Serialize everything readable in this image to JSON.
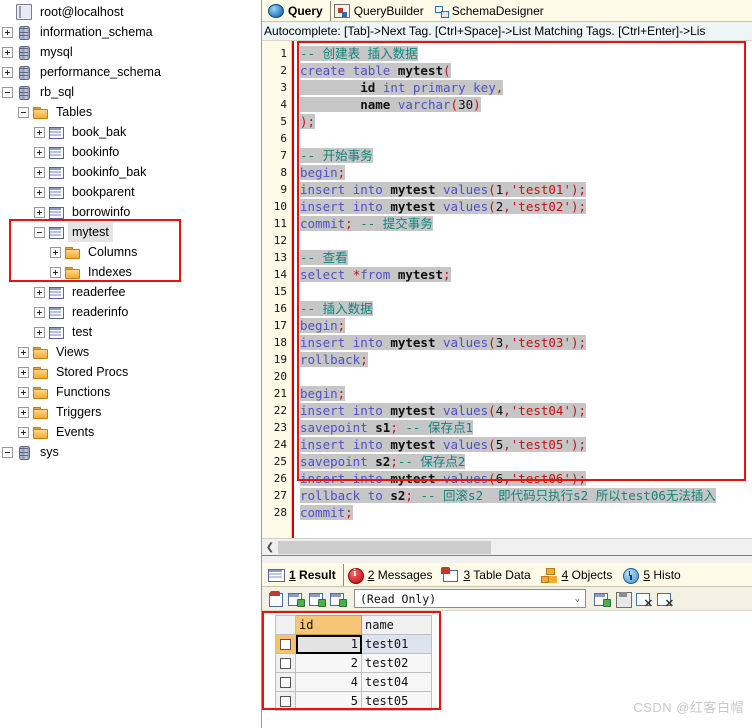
{
  "sidebar": {
    "items": [
      {
        "label": "root@localhost",
        "icon": "host-icon",
        "indent": 0,
        "expander": "none",
        "selected": false
      },
      {
        "label": "information_schema",
        "icon": "database-icon",
        "indent": 0,
        "expander": "plus",
        "selected": false
      },
      {
        "label": "mysql",
        "icon": "database-icon",
        "indent": 0,
        "expander": "plus",
        "selected": false
      },
      {
        "label": "performance_schema",
        "icon": "database-icon",
        "indent": 0,
        "expander": "plus",
        "selected": false
      },
      {
        "label": "rb_sql",
        "icon": "database-icon",
        "indent": 0,
        "expander": "minus",
        "selected": false
      },
      {
        "label": "Tables",
        "icon": "folder-icon",
        "indent": 1,
        "expander": "minus",
        "selected": false
      },
      {
        "label": "book_bak",
        "icon": "table-icon",
        "indent": 2,
        "expander": "plus",
        "selected": false
      },
      {
        "label": "bookinfo",
        "icon": "table-icon",
        "indent": 2,
        "expander": "plus",
        "selected": false
      },
      {
        "label": "bookinfo_bak",
        "icon": "table-icon",
        "indent": 2,
        "expander": "plus",
        "selected": false
      },
      {
        "label": "bookparent",
        "icon": "table-icon",
        "indent": 2,
        "expander": "plus",
        "selected": false
      },
      {
        "label": "borrowinfo",
        "icon": "table-icon",
        "indent": 2,
        "expander": "plus",
        "selected": false
      },
      {
        "label": "mytest",
        "icon": "table-icon",
        "indent": 2,
        "expander": "minus",
        "selected": true
      },
      {
        "label": "Columns",
        "icon": "folder-icon",
        "indent": 3,
        "expander": "plus",
        "selected": false
      },
      {
        "label": "Indexes",
        "icon": "folder-icon",
        "indent": 3,
        "expander": "plus",
        "selected": false
      },
      {
        "label": "readerfee",
        "icon": "table-icon",
        "indent": 2,
        "expander": "plus",
        "selected": false
      },
      {
        "label": "readerinfo",
        "icon": "table-icon",
        "indent": 2,
        "expander": "plus",
        "selected": false
      },
      {
        "label": "test",
        "icon": "table-icon",
        "indent": 2,
        "expander": "plus",
        "selected": false
      },
      {
        "label": "Views",
        "icon": "folder-icon",
        "indent": 1,
        "expander": "plus",
        "selected": false
      },
      {
        "label": "Stored Procs",
        "icon": "folder-icon",
        "indent": 1,
        "expander": "plus",
        "selected": false
      },
      {
        "label": "Functions",
        "icon": "folder-icon",
        "indent": 1,
        "expander": "plus",
        "selected": false
      },
      {
        "label": "Triggers",
        "icon": "folder-icon",
        "indent": 1,
        "expander": "plus",
        "selected": false
      },
      {
        "label": "Events",
        "icon": "folder-icon",
        "indent": 1,
        "expander": "plus",
        "selected": false
      },
      {
        "label": "sys",
        "icon": "database-icon",
        "indent": 0,
        "expander": "minus",
        "selected": false
      }
    ]
  },
  "editor_tabs": [
    {
      "label": "Query",
      "icon": "globe-icon",
      "active": true
    },
    {
      "label": "QueryBuilder",
      "icon": "query-builder-icon",
      "active": false
    },
    {
      "label": "SchemaDesigner",
      "icon": "schema-designer-icon",
      "active": false
    }
  ],
  "hint_bar": {
    "text": "Autocomplete: [Tab]->Next Tag. [Ctrl+Space]->List Matching Tags. [Ctrl+Enter]->Lis"
  },
  "editor": {
    "line_numbers": [
      1,
      2,
      3,
      4,
      5,
      6,
      7,
      8,
      9,
      10,
      11,
      12,
      13,
      14,
      15,
      16,
      17,
      18,
      19,
      20,
      21,
      22,
      23,
      24,
      25,
      26,
      27,
      28
    ],
    "lines": [
      "-- 创建表 插入数据",
      "create table mytest(",
      "        id int primary key,",
      "        name varchar(30)",
      ");",
      "",
      "-- 开始事务",
      "begin;",
      "insert into mytest values(1,'test01');",
      "insert into mytest values(2,'test02');",
      "commit; -- 提交事务",
      "",
      "-- 查看",
      "select *from mytest;",
      "",
      "-- 插入数据",
      "begin;",
      "insert into mytest values(3,'test03');",
      "rollback;",
      "",
      "begin;",
      "insert into mytest values(4,'test04');",
      "savepoint s1; -- 保存点1",
      "insert into mytest values(5,'test05');",
      "savepoint s2;-- 保存点2",
      "insert into mytest values(6,'test06');",
      "rollback to s2; -- 回滚s2  即代码只执行s2 所以test06无法插入",
      "commit;"
    ]
  },
  "result_tabs": [
    {
      "num": "1",
      "label": "Result",
      "icon": "grid-icon",
      "active": true
    },
    {
      "num": "2",
      "label": "Messages",
      "icon": "info-icon",
      "active": false
    },
    {
      "num": "3",
      "label": "Table Data",
      "icon": "table-data-icon",
      "active": false
    },
    {
      "num": "4",
      "label": "Objects",
      "icon": "objects-icon",
      "active": false
    },
    {
      "num": "5",
      "label": "Histo",
      "icon": "history-icon",
      "active": false
    }
  ],
  "result_toolbar": {
    "mode_value": "(Read Only)",
    "chevron": "⌄",
    "buttons": [
      "export-icon",
      "grid-add-icon",
      "grid-edit-icon",
      "grid-copy-icon",
      "row-add-icon",
      "save-icon",
      "row-delete-icon",
      "clear-icon"
    ]
  },
  "result_grid": {
    "columns": [
      "",
      "id",
      "name"
    ],
    "rows": [
      {
        "id": "1",
        "name": "test01",
        "selected": true
      },
      {
        "id": "2",
        "name": "test02",
        "selected": false
      },
      {
        "id": "4",
        "name": "test04",
        "selected": false
      },
      {
        "id": "5",
        "name": "test05",
        "selected": false
      }
    ]
  },
  "watermark": {
    "text": "CSDN @红客白帽"
  },
  "colors": {
    "annotation_red": "#e8130f",
    "keyword": "#5050c8",
    "string": "#c01414",
    "comment": "#11847d",
    "selection_gray": "#c6c6c6",
    "id_header_orange": "#f7c577"
  }
}
